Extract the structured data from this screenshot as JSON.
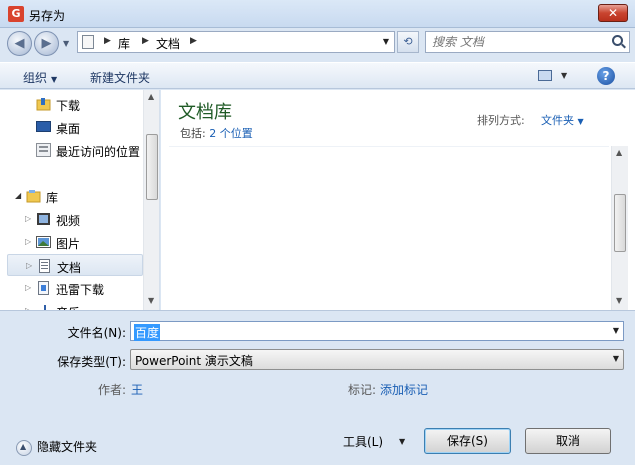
{
  "window": {
    "title": "另存为",
    "app_icon_glyph": "G",
    "close_glyph": "✕"
  },
  "address": {
    "crumbs": [
      "库",
      "文档"
    ],
    "search_placeholder": "搜索 文档"
  },
  "toolbar": {
    "organize": "组织",
    "new_folder": "新建文件夹",
    "help_glyph": "?"
  },
  "nav": {
    "favorites": [
      {
        "label": "下载",
        "icon": "download-folder-icon"
      },
      {
        "label": "桌面",
        "icon": "desktop-icon"
      },
      {
        "label": "最近访问的位置",
        "icon": "recent-places-icon"
      }
    ],
    "library_label": "库",
    "libraries": [
      {
        "label": "视频",
        "icon": "video-library-icon"
      },
      {
        "label": "图片",
        "icon": "pictures-library-icon"
      },
      {
        "label": "文档",
        "icon": "documents-library-icon",
        "selected": true
      },
      {
        "label": "迅雷下载",
        "icon": "thunder-download-icon"
      },
      {
        "label": "音乐",
        "icon": "music-library-icon"
      }
    ]
  },
  "content": {
    "library_title": "文档库",
    "includes_label": "包括:",
    "includes_link": "2 个位置",
    "sort_label": "排列方式:",
    "sort_value": "文件夹"
  },
  "form": {
    "filename_label": "文件名(N):",
    "filename_value": "百度",
    "filetype_label": "保存类型(T):",
    "filetype_value": "PowerPoint 演示文稿",
    "author_label": "作者:",
    "author_value": "王",
    "tags_label": "标记:",
    "tags_value": "添加标记",
    "hide_folders": "隐藏文件夹",
    "tools": "工具(L)",
    "save": "保存(S)",
    "cancel": "取消"
  },
  "colors": {
    "accent_link": "#1a5fb4",
    "library_title": "#1e5a25",
    "selection": "#3399ff"
  }
}
